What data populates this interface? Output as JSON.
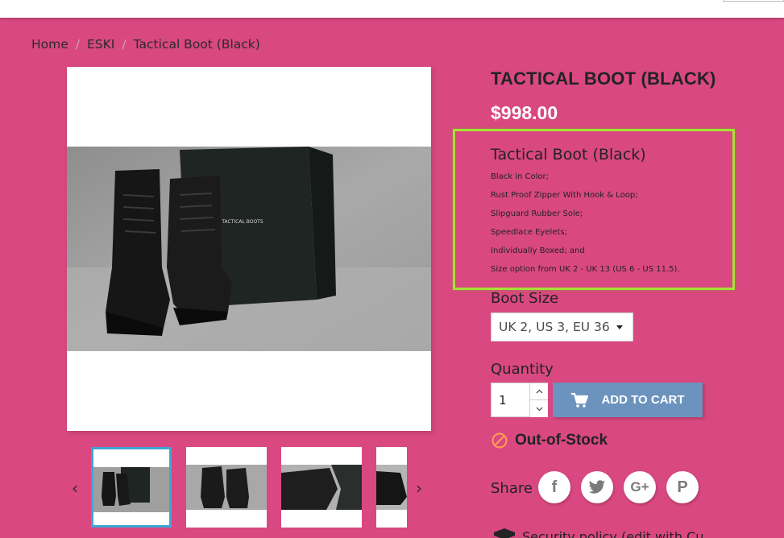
{
  "breadcrumb": {
    "items": [
      "Home",
      "ESKI",
      "Tactical Boot (Black)"
    ],
    "separator": "/"
  },
  "product": {
    "title": "TACTICAL BOOT (BLACK)",
    "price": "$998.00",
    "image_box_text": "TACTICAL BOOTS",
    "description_title": "Tactical Boot (Black)",
    "description_lines": [
      "Black in Color;",
      "Rust Proof Zipper With Hook & Loop;",
      "Slipguard Rubber Sole;",
      "Speedlace Eyelets;",
      "Individually Boxed; and",
      "Size option from UK 2 - UK 13 (US 6 - US 11.5)."
    ]
  },
  "options": {
    "size_label": "Boot Size",
    "size_selected": "UK 2, US 3, EU 36"
  },
  "quantity": {
    "label": "Quantity",
    "value": "1"
  },
  "cart": {
    "add_label": "ADD TO CART"
  },
  "stock": {
    "status": "Out-of-Stock"
  },
  "share": {
    "label": "Share",
    "networks": [
      "facebook-icon",
      "twitter-icon",
      "google-plus-icon",
      "pinterest-icon"
    ]
  },
  "thumb_nav": {
    "prev": "‹",
    "next": "›"
  },
  "bottom": {
    "text": "Security policy (edit with Cu"
  },
  "colors": {
    "background": "#d94880",
    "highlight_border": "#a5e236",
    "add_to_cart": "#6c93be",
    "selected_thumb": "#3fa5d4"
  }
}
